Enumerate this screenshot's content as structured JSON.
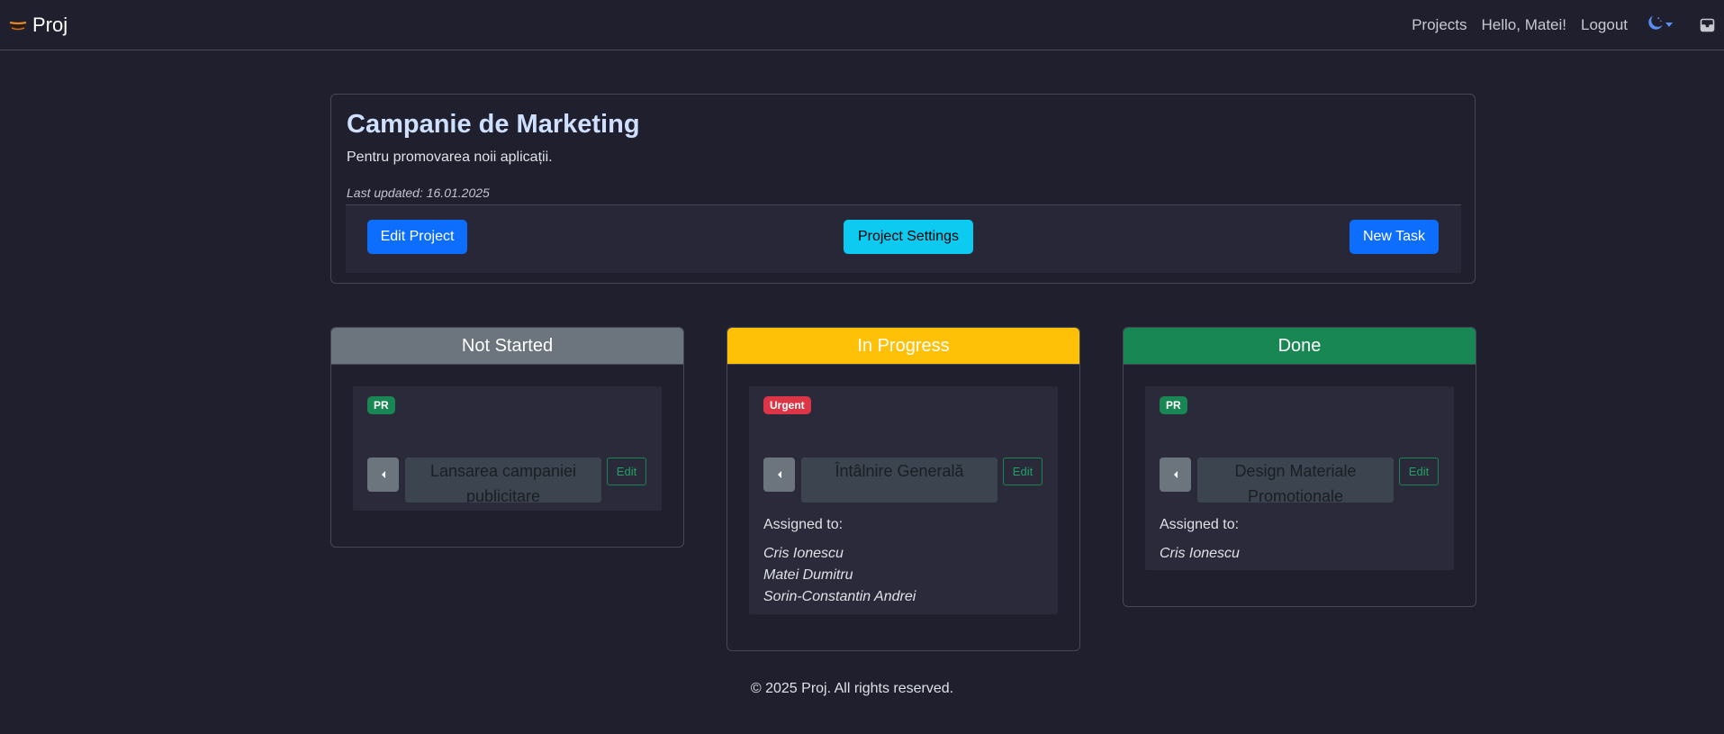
{
  "navbar": {
    "brand": "Proj",
    "links": [
      "Projects",
      "Hello, Matei!",
      "Logout"
    ],
    "icons": [
      "brand-logo-icon",
      "moon-icon",
      "inbox-icon"
    ]
  },
  "project": {
    "title": "Campanie de Marketing",
    "description": "Pentru promovarea noii aplicații.",
    "last_updated": "Last updated: 16.01.2025",
    "buttons": {
      "edit": "Edit Project",
      "settings": "Project Settings",
      "new_task": "New Task"
    }
  },
  "columns": [
    {
      "title": "Not Started",
      "color": "#6c757d",
      "tasks": [
        {
          "badge": "PR",
          "badge_color": "#198754",
          "name": "Lansarea campaniei publicitare",
          "edit": "Edit",
          "assigned_label": "",
          "assignees": []
        }
      ]
    },
    {
      "title": "In Progress",
      "color": "#ffc107",
      "tasks": [
        {
          "badge": "Urgent",
          "badge_color": "#dc3545",
          "name": "Întâlnire Generală",
          "edit": "Edit",
          "assigned_label": "Assigned to:",
          "assignees": [
            "Cris Ionescu",
            "Matei Dumitru",
            "Sorin-Constantin Andrei"
          ]
        }
      ]
    },
    {
      "title": "Done",
      "color": "#198754",
      "tasks": [
        {
          "badge": "PR",
          "badge_color": "#198754",
          "name": "Design Materiale Promoționale",
          "edit": "Edit",
          "assigned_label": "Assigned to:",
          "assignees": [
            "Cris Ionescu"
          ]
        }
      ]
    }
  ],
  "footer": "© 2025 Proj. All rights reserved."
}
